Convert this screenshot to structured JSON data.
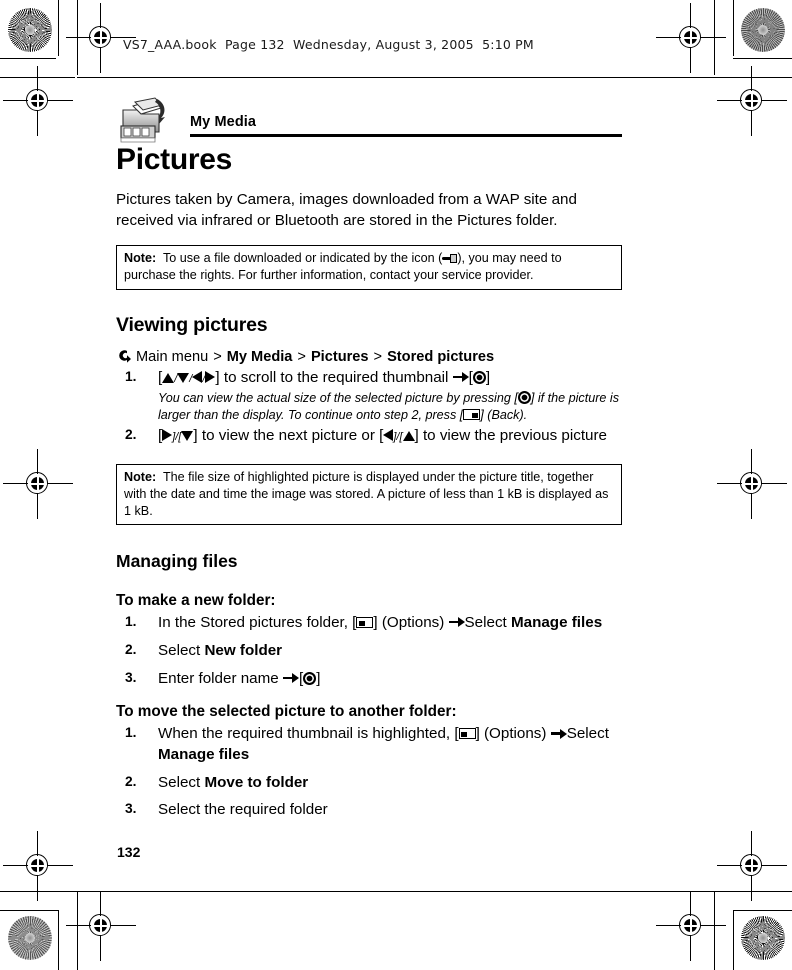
{
  "scan": {
    "header_line": "VS7_AAA.book  Page 132  Wednesday, August 3, 2005  5:10 PM"
  },
  "chapter": {
    "icon": "my-media-folder-icon",
    "title": "My Media"
  },
  "page": {
    "title": "Pictures",
    "number": "132",
    "intro": "Pictures taken by Camera, images downloaded from a WAP site and received via infrared or Bluetooth are stored in the Pictures folder."
  },
  "notes": [
    {
      "label": "Note:",
      "text_before_icon": "To use a file downloaded or indicated by the icon (",
      "icon": "drm-key-icon",
      "text_after_icon": "), you may need to purchase the rights. For further information, contact your service provider."
    },
    {
      "label": "Note:",
      "text": "The file size of highlighted picture is displayed under the picture title, together with the date and time the image was stored. A picture of less than 1 kB is displayed as 1 kB."
    }
  ],
  "viewing": {
    "heading": "Viewing pictures",
    "path": {
      "arrow_icon": "hook-arrow-icon",
      "root": "Main menu",
      "sep": ">",
      "crumb1": "My Media",
      "crumb2": "Pictures",
      "crumb3": "Stored pictures"
    },
    "steps": [
      {
        "num": "1.",
        "pre": "[",
        "keys": "up/down/left/right",
        "mid": "] to scroll to the required thumbnail",
        "arrow": "arrow-to-icon",
        "post_open": "[",
        "post_key": "center-select-key",
        "post_close": "]",
        "italic_a": "You can view the actual size of the selected picture by pressing [",
        "italic_key_a": "center-select-key",
        "italic_b": "] if the picture is larger than the display. To continue onto step 2, press [",
        "italic_key_b": "right-soft-key",
        "italic_c": "] (Back)."
      },
      {
        "num": "2.",
        "text_a": "] to view the next picture or [",
        "text_b": "] to view the previous picture"
      }
    ]
  },
  "managing": {
    "heading": "Managing files",
    "sections": [
      {
        "title": "To make a new folder:",
        "steps": [
          {
            "num": "1.",
            "a": "In the Stored pictures folder, [",
            "key": "left-soft-key",
            "b": "] (Options)",
            "arrow": "arrow-to-icon",
            "c": "Select ",
            "bold": "Manage files"
          },
          {
            "num": "2.",
            "a": "Select ",
            "bold": "New folder"
          },
          {
            "num": "3.",
            "a": "Enter folder name",
            "arrow": "arrow-to-icon",
            "b": "[",
            "key": "center-select-key",
            "c": "]"
          }
        ]
      },
      {
        "title": "To move the selected picture to another folder:",
        "steps": [
          {
            "num": "1.",
            "a": "When the required thumbnail is highlighted, [",
            "key": "left-soft-key",
            "b": "] (Options)",
            "arrow": "arrow-to-icon",
            "c": "Select ",
            "bold": "Manage files"
          },
          {
            "num": "2.",
            "a": "Select ",
            "bold": "Move to folder"
          },
          {
            "num": "3.",
            "a": "Select the required folder",
            "bold": ""
          }
        ]
      }
    ]
  },
  "colors": {
    "ink": "#000000",
    "paper": "#ffffff",
    "reg_gray": "#b9b9b9"
  }
}
